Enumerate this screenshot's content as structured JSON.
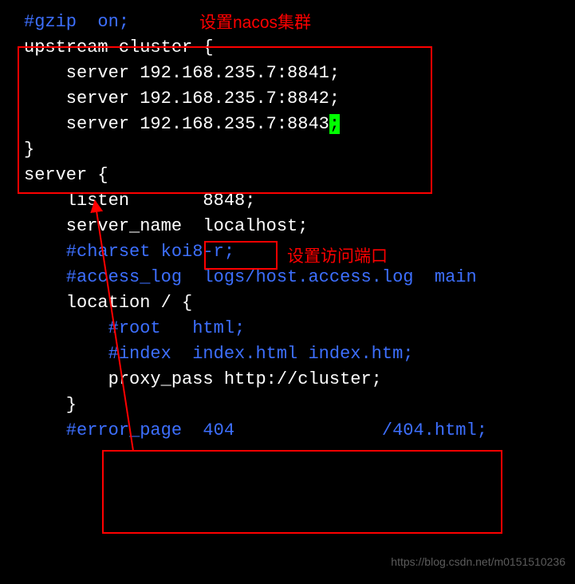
{
  "annotations": {
    "setNacosCluster": "设置nacos集群",
    "setAccessPort": "设置访问端口"
  },
  "code": {
    "l1": "#gzip  on;",
    "l2": "",
    "l3": "upstream cluster {",
    "l4": "    server 192.168.235.7:8841;",
    "l5": "    server 192.168.235.7:8842;",
    "l6_pre": "    server 192.168.235.7:8843",
    "l6_cursor": ";",
    "l7": "}",
    "l8": "",
    "l9": "server {",
    "l10": "    listen       8848;",
    "l11": "    server_name  localhost;",
    "l12": "",
    "l13": "    #charset koi8-r;",
    "l14": "",
    "l15": "    #access_log  logs/host.access.log  main",
    "l16": "",
    "l17": "    location / {",
    "l18": "        #root   html;",
    "l19": "        #index  index.html index.htm;",
    "l20": "        proxy_pass http://cluster;",
    "l21": "    }",
    "l22": "",
    "l23": "    #error_page  404              /404.html;"
  },
  "watermark": "https://blog.csdn.net/m0151510236"
}
